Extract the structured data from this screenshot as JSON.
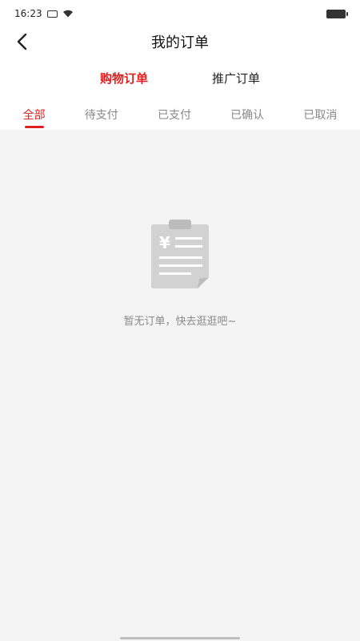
{
  "status_bar": {
    "time": "16:23",
    "icons": [
      "sim-icon",
      "wifi-icon",
      "battery-icon"
    ]
  },
  "header": {
    "title": "我的订单",
    "back_icon": "chevron-left-icon"
  },
  "main_tabs": [
    {
      "label": "购物订单",
      "active": true
    },
    {
      "label": "推广订单",
      "active": false
    }
  ],
  "sub_tabs": [
    {
      "label": "全部",
      "active": true
    },
    {
      "label": "待支付",
      "active": false
    },
    {
      "label": "已支付",
      "active": false
    },
    {
      "label": "已确认",
      "active": false
    },
    {
      "label": "已取消",
      "active": false
    }
  ],
  "empty_state": {
    "icon": "clipboard-yen-icon",
    "message": "暂无订单，快去逛逛吧~"
  },
  "colors": {
    "accent": "#e02020",
    "content_bg": "#f4f4f4",
    "muted_text": "#888888"
  }
}
